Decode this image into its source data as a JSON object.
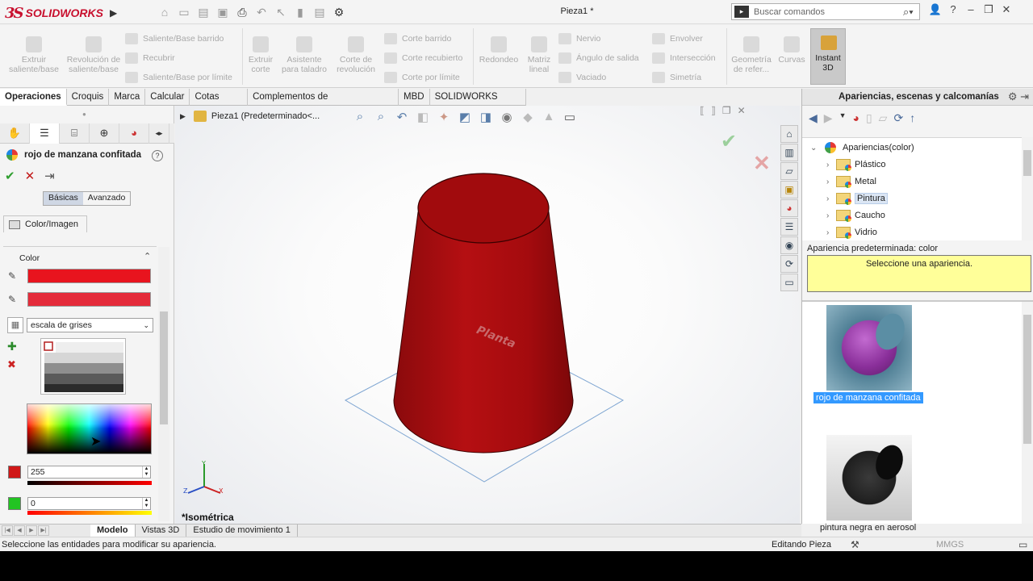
{
  "app": {
    "brand_ds": "3S",
    "brand_name": "SOLIDWORKS",
    "title": "Pieza1 *",
    "search_placeholder": "Buscar comandos"
  },
  "ribbon": {
    "extruir_saliente": "Extruir saliente/base",
    "revolucion_saliente": "Revolución de saliente/base",
    "saliente_barrido": "Saliente/Base barrido",
    "recubrir": "Recubrir",
    "saliente_limite": "Saliente/Base por límite",
    "extruir_corte": "Extruir corte",
    "asistente_taladro": "Asistente para taladro",
    "corte_revolucion": "Corte de revolución",
    "corte_barrido": "Corte barrido",
    "corte_recubierto": "Corte recubierto",
    "corte_limite": "Corte por límite",
    "redondeo": "Redondeo",
    "matriz_lineal": "Matriz lineal",
    "nervio": "Nervio",
    "angulo_salida": "Ángulo de salida",
    "vaciado": "Vaciado",
    "envolver": "Envolver",
    "interseccion": "Intersección",
    "simetria": "Simetría",
    "geometria_ref": "Geometría de refer...",
    "curvas": "Curvas",
    "instant3d": "Instant 3D"
  },
  "command_tabs": [
    "Operaciones",
    "Croquis",
    "Marca",
    "Calcular",
    "Cotas MBD",
    "Complementos de SOLIDWORKS",
    "MBD",
    "SOLIDWORKS CAM"
  ],
  "property_manager": {
    "title": "rojo de manzana confitada",
    "basic_tab": "Básicas",
    "advanced_tab": "Avanzado",
    "color_image_tab": "Color/Imagen",
    "color_group": "Color",
    "color_primary": "#e8141e",
    "color_secondary": "#e42b3a",
    "mode_select": "escala de grises",
    "red_value": "255",
    "green_value": "0"
  },
  "graphics": {
    "breadcrumb": "Pieza1  (Predeterminado<...",
    "view_name": "*Isométrica",
    "engraved_text": "Planta",
    "part_color": "#9b0a0c"
  },
  "appearances": {
    "header": "Apariencias, escenas y calcomanías",
    "root": "Apariencias(color)",
    "categories": [
      "Plástico",
      "Metal",
      "Pintura",
      "Caucho",
      "Vidrio"
    ],
    "default_label": "Apariencia predeterminada: color",
    "hint": "Seleccione una apariencia.",
    "thumb1_label": "rojo de manzana confitada",
    "thumb2_label": "pintura negra en aerosol"
  },
  "bottom_tabs": [
    "Modelo",
    "Vistas 3D",
    "Estudio de movimiento 1"
  ],
  "status": {
    "message": "Seleccione las entidades para modificar su apariencia.",
    "mode": "Editando Pieza",
    "units": "MMGS"
  }
}
